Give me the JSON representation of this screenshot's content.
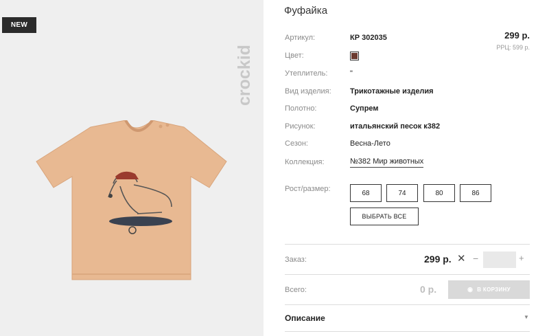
{
  "badge": "NEW",
  "brand": "crockid",
  "product": {
    "title": "Фуфайка",
    "price": "299 р.",
    "rrc": "РРЦ: 599 р."
  },
  "specs": [
    {
      "label": "Артикул:",
      "value": "КР 302035"
    },
    {
      "label": "Цвет:",
      "value": ""
    },
    {
      "label": "Утеплитель:",
      "value": "\""
    },
    {
      "label": "Вид изделия:",
      "value": "Трикотажные изделия"
    },
    {
      "label": "Полотно:",
      "value": "Супрем"
    },
    {
      "label": "Рисунок:",
      "value": "итальянский песок к382"
    },
    {
      "label": "Сезон:",
      "value": "Весна-Лето"
    },
    {
      "label": "Коллекция:",
      "value": "№382 Мир животных"
    }
  ],
  "color_swatch": "#6b3a2f",
  "sizes": {
    "label": "Рост/размер:",
    "options": [
      "68",
      "74",
      "80",
      "86"
    ],
    "select_all": "ВЫБРАТЬ ВСЕ"
  },
  "order": {
    "label": "Заказ:",
    "price": "299 р.",
    "times": "✕",
    "minus": "−",
    "plus": "+",
    "quantity": ""
  },
  "total": {
    "label": "Всего:",
    "value": "0 р.",
    "cart_button": "В КОРЗИНУ"
  },
  "description": {
    "label": "Описание"
  }
}
